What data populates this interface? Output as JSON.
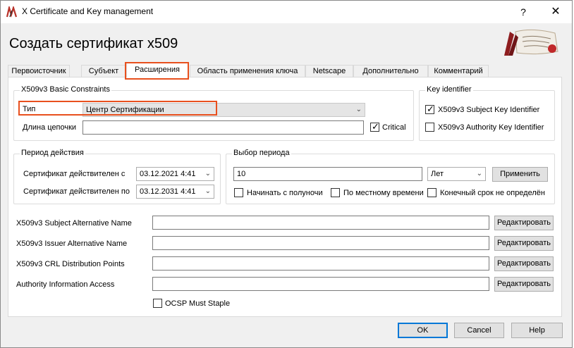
{
  "window": {
    "title": "X Certificate and Key management",
    "help_glyph": "?",
    "close_glyph": "✕"
  },
  "dialog": {
    "title": "Создать сертификат x509"
  },
  "tabs": [
    {
      "label": "Первоисточник"
    },
    {
      "label": "Субъект"
    },
    {
      "label": "Расширения",
      "active": true
    },
    {
      "label": "Область применения ключа"
    },
    {
      "label": "Netscape"
    },
    {
      "label": "Дополнительно"
    },
    {
      "label": "Комментарий"
    }
  ],
  "basic_constraints": {
    "title": "X509v3 Basic Constraints",
    "type_label": "Тип",
    "type_value": "Центр Сертификации",
    "path_len_label": "Длина цепочки",
    "path_len_value": "",
    "critical_label": "Critical",
    "critical_checked": true
  },
  "key_identifier": {
    "title": "Key identifier",
    "subject_label": "X509v3 Subject Key Identifier",
    "subject_checked": true,
    "authority_label": "X509v3 Authority Key Identifier",
    "authority_checked": false
  },
  "validity": {
    "title": "Период действия",
    "from_label": "Сертификат действителен с",
    "from_value": "03.12.2021 4:41",
    "to_label": "Сертификат действителен по",
    "to_value": "03.12.2031 4:41"
  },
  "period": {
    "title": "Выбор периода",
    "amount": "10",
    "unit": "Лет",
    "apply_label": "Применить",
    "midnight_label": "Начинать с полуночи",
    "midnight_checked": false,
    "localtime_label": "По местному времени",
    "localtime_checked": false,
    "undefined_label": "Конечный срок не определён",
    "undefined_checked": false
  },
  "extensions": [
    {
      "label": "X509v3 Subject Alternative Name",
      "value": "",
      "button": "Редактировать"
    },
    {
      "label": "X509v3 Issuer Alternative Name",
      "value": "",
      "button": "Редактировать"
    },
    {
      "label": "X509v3 CRL Distribution Points",
      "value": "",
      "button": "Редактировать"
    },
    {
      "label": "Authority Information Access",
      "value": "",
      "button": "Редактировать"
    }
  ],
  "ocsp": {
    "label": "OCSP Must Staple",
    "checked": false
  },
  "footer": {
    "ok": "OK",
    "cancel": "Cancel",
    "help": "Help"
  },
  "colors": {
    "highlight": "#e8501e",
    "accent": "#0078d7"
  },
  "icons": {
    "app": "xca-app-icon",
    "logo": "certificate-seal-logo",
    "dropdown": "chevron-down-icon"
  }
}
